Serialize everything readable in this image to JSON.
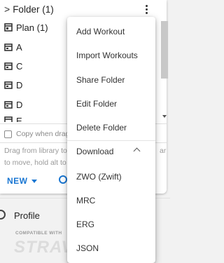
{
  "library": {
    "folder_title": "Folder (1)",
    "items": [
      {
        "label": "Plan (1)",
        "icon": "plan-icon"
      },
      {
        "label": "A",
        "icon": "calendar-icon"
      },
      {
        "label": "C",
        "icon": "calendar-icon"
      },
      {
        "label": "D",
        "icon": "calendar-icon"
      },
      {
        "label": "D",
        "icon": "calendar-icon"
      },
      {
        "label": "E",
        "icon": "calendar-icon"
      }
    ],
    "copy_label": "Copy when drag",
    "hint_line1": "Drag from library to",
    "hint_line1_right": "ar",
    "hint_line2": "to move, hold alt to",
    "new_label": "NEW"
  },
  "menu": {
    "items": [
      "Add Workout",
      "Import Workouts",
      "Share Folder",
      "Edit Folder",
      "Delete Folder"
    ],
    "download_label": "Download",
    "download_items": [
      "ZWO (Zwift)",
      "MRC",
      "ERG",
      "JSON"
    ]
  },
  "sidebar": {
    "profile_label": "Profile",
    "compat_text": "COMPATIBLE WITH",
    "strava_text": "STRAVA"
  },
  "colors": {
    "accent": "#1976d2",
    "menu_bg": "#ffffff",
    "page_bg": "#f2f2f2"
  }
}
